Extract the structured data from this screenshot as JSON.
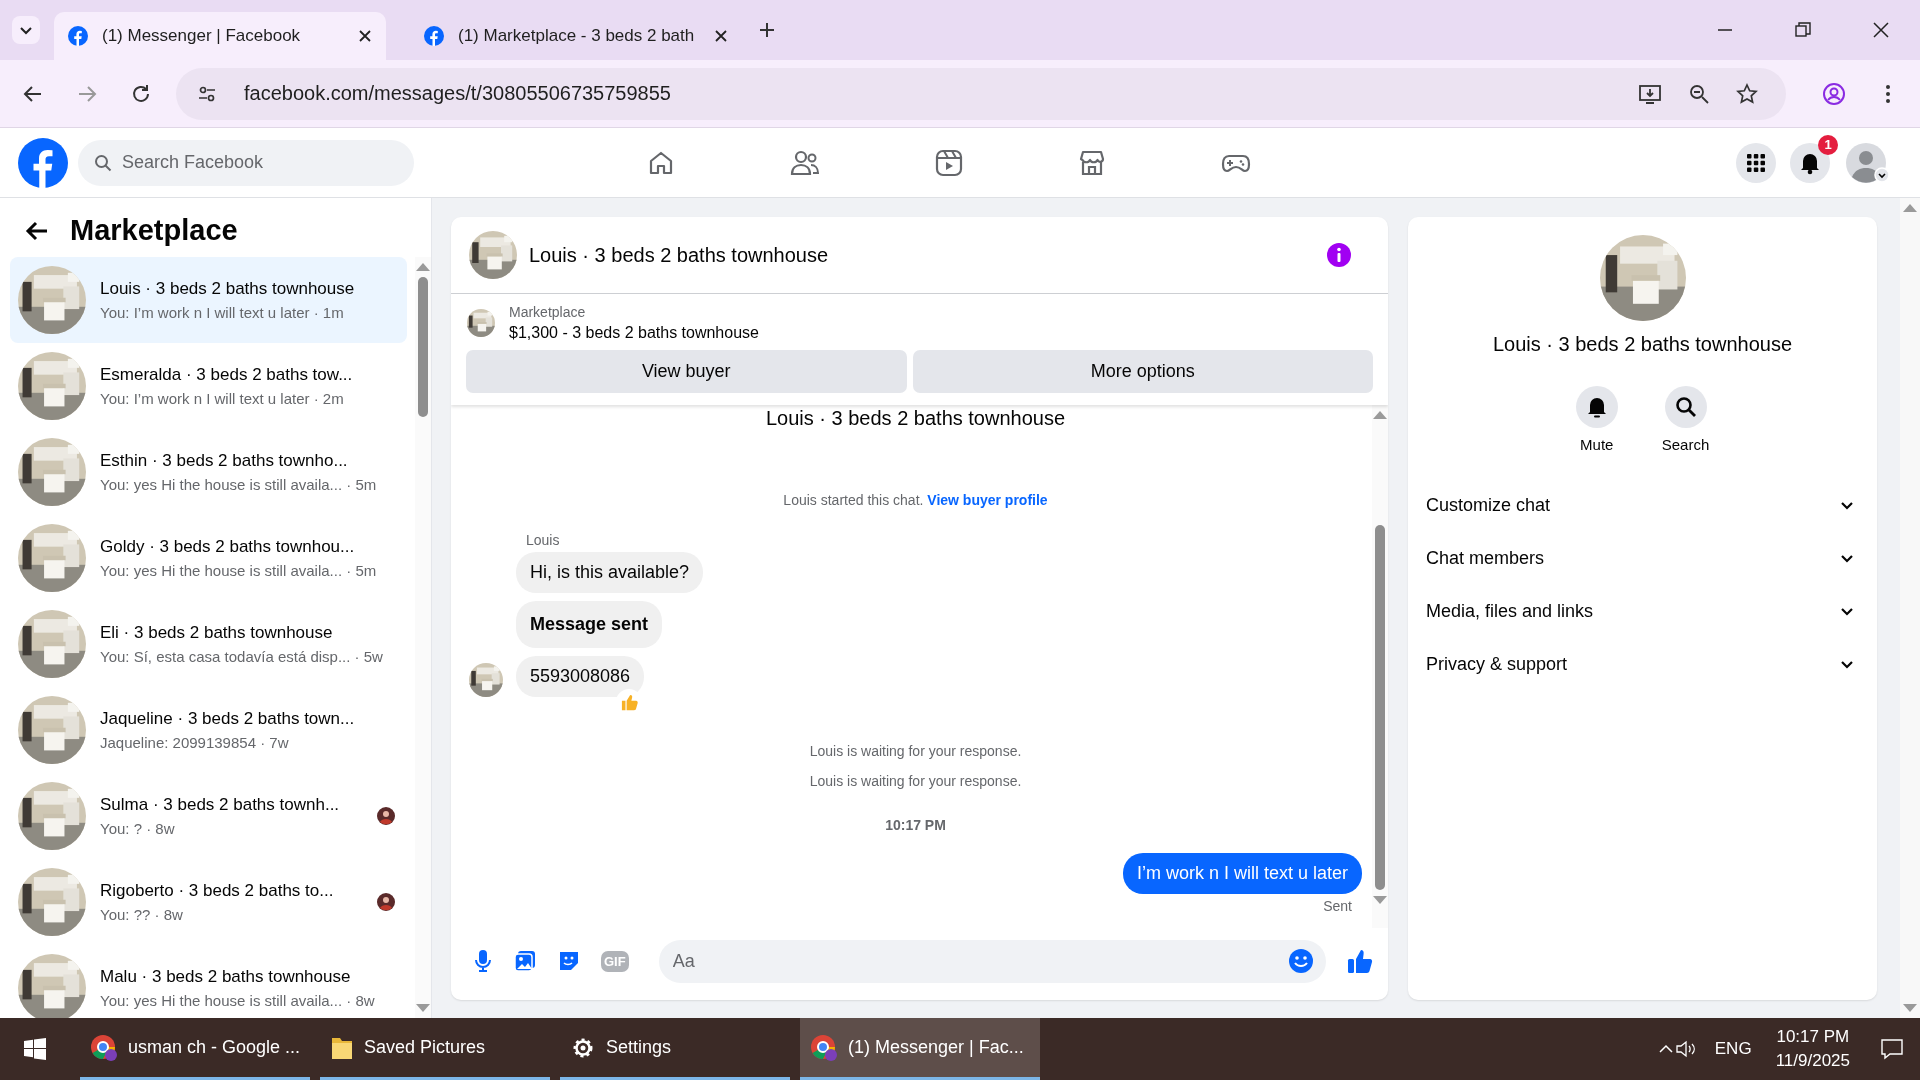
{
  "browser": {
    "tabs": [
      {
        "title": "(1) Messenger | Facebook",
        "selected": true
      },
      {
        "title": "(1) Marketplace - 3 beds 2 bath",
        "selected": false
      }
    ],
    "url": "facebook.com/messages/t/30805506735759855"
  },
  "topbar": {
    "search_placeholder": "Search Facebook",
    "notification_count": "1"
  },
  "sidebar": {
    "title": "Marketplace",
    "conversations": [
      {
        "name": "Louis · 3 beds 2 baths townhouse",
        "preview": "You: I’m work n I will text u later · 1m",
        "selected": true,
        "seen": false
      },
      {
        "name": "Esmeralda · 3 beds 2 baths tow...",
        "preview": "You: I’m work n I will text u later · 2m",
        "selected": false,
        "seen": false
      },
      {
        "name": "Esthin · 3 beds 2 baths townho...",
        "preview": "You: yes Hi the house is still availa... · 5m",
        "selected": false,
        "seen": false
      },
      {
        "name": "Goldy · 3 beds 2 baths townhou...",
        "preview": "You: yes Hi the house is still availa... · 5m",
        "selected": false,
        "seen": false
      },
      {
        "name": "Eli · 3 beds 2 baths townhouse",
        "preview": "You: Sí, esta casa todavía está disp... · 5w",
        "selected": false,
        "seen": false
      },
      {
        "name": "Jaqueline · 3 beds 2 baths town...",
        "preview": "Jaqueline: 2099139854 · 7w",
        "selected": false,
        "seen": false
      },
      {
        "name": "Sulma · 3 beds 2 baths townh...",
        "preview": "You: ? · 8w",
        "selected": false,
        "seen": true
      },
      {
        "name": "Rigoberto · 3 beds 2 baths to...",
        "preview": "You: ?? · 8w",
        "selected": false,
        "seen": true
      },
      {
        "name": "Malu · 3 beds 2 baths townhouse",
        "preview": "You: yes Hi the house is still availa... · 8w",
        "selected": false,
        "seen": false
      }
    ]
  },
  "chat": {
    "title": "Louis · 3 beds 2 baths townhouse",
    "listing": {
      "label": "Marketplace",
      "text": "$1,300 - 3 beds 2 baths townhouse"
    },
    "buttons": [
      "View buyer",
      "More options"
    ],
    "thread_heading": "Louis · 3 beds 2 baths townhouse",
    "started": {
      "text": "Louis started this chat.",
      "link": "View buyer profile"
    },
    "sender": "Louis",
    "messages": [
      {
        "text": "Hi, is this available?",
        "bold": false,
        "reacted": false
      },
      {
        "text": "Message sent",
        "bold": true,
        "reacted": false
      },
      {
        "text": "5593008086",
        "bold": false,
        "reacted": true
      }
    ],
    "notices": [
      "Louis is waiting for your response.",
      "Louis is waiting for your response."
    ],
    "time": "10:17 PM",
    "outgoing": "I’m work n I will text u later",
    "status": "Sent",
    "composer": {
      "gif": "GIF",
      "placeholder": "Aa"
    }
  },
  "details": {
    "title": "Louis · 3 beds 2 baths townhouse",
    "actions": [
      {
        "kind": "mute",
        "label": "Mute"
      },
      {
        "kind": "search",
        "label": "Search"
      }
    ],
    "sections": [
      "Customize chat",
      "Chat members",
      "Media, files and links",
      "Privacy & support"
    ]
  },
  "taskbar": {
    "apps": [
      {
        "kind": "chrome",
        "label": "usman ch - Google ...",
        "selected": false
      },
      {
        "kind": "folder",
        "label": "Saved Pictures",
        "selected": false
      },
      {
        "kind": "settings",
        "label": "Settings",
        "selected": false
      },
      {
        "kind": "chrome",
        "label": "(1) Messenger | Fac...",
        "selected": true
      }
    ],
    "language": "ENG",
    "time": "10:17 PM",
    "date": "11/9/2025"
  }
}
